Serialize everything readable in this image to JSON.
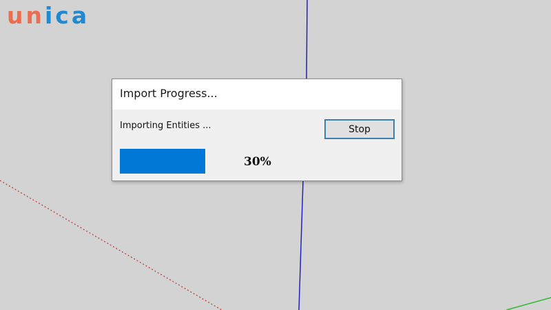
{
  "logo": {
    "text_part1": "un",
    "text_part2": "ica",
    "color_primary": "#ef6d4f",
    "color_secondary": "#1f8ad2"
  },
  "scene": {
    "background_color": "#d3d3d3",
    "axis_blue_color": "#2020c0",
    "axis_red_dotted_color": "#c0504d",
    "axis_green_color": "#2eb82e"
  },
  "dialog": {
    "title": "Import Progress...",
    "status_text": "Importing Entities ...",
    "stop_label": "Stop",
    "progress_fraction": 0.3,
    "progress_label": "30%",
    "accent_color": "#0078d7"
  }
}
